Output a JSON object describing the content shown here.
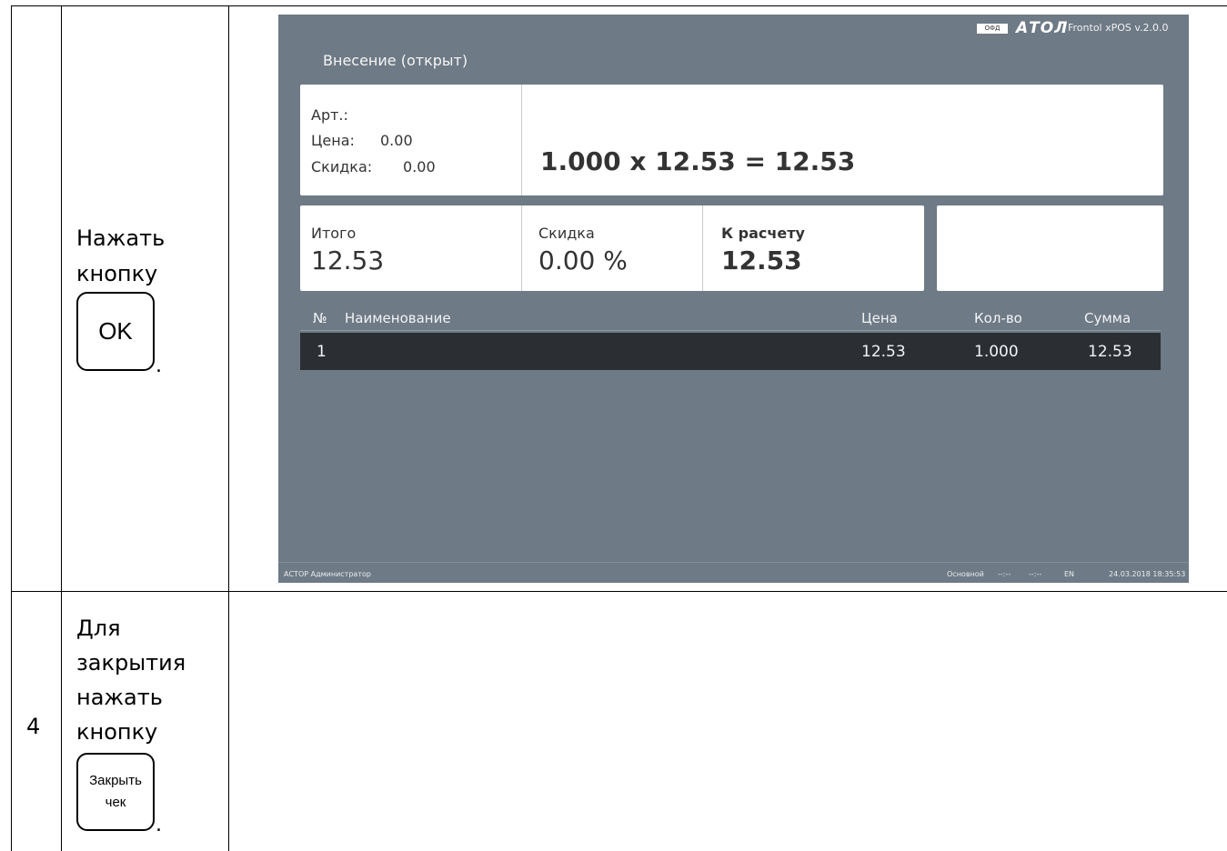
{
  "row3": {
    "instruction_line1": "Нажать",
    "instruction_line2": "кнопку",
    "key_label": "OK",
    "period": "."
  },
  "row4": {
    "number": "4",
    "instruction_lines": [
      "Для",
      "закрытия",
      "нажать",
      "кнопку"
    ],
    "key_line1": "Закрыть",
    "key_line2": "чек",
    "period": "."
  },
  "pos": {
    "ofd_badge": "ОФД",
    "logo": "АТОЛ",
    "version": "Frontol xPOS v.2.0.0",
    "mode_title": "Внесение (открыт)",
    "art_label": "Арт.:",
    "price_label": "Цена:",
    "price_value": "0.00",
    "discount_label": "Скидка:",
    "discount_value": "0.00",
    "formula": "1.000 x 12.53 = 12.53",
    "total_label": "Итого",
    "total_value": "12.53",
    "discount_pct_label": "Скидка",
    "discount_pct_value": "0.00 %",
    "to_pay_label": "К расчету",
    "to_pay_value": "12.53",
    "table": {
      "headers": [
        "№",
        "Наименование",
        "Цена",
        "Кол-во",
        "Сумма"
      ],
      "rows": [
        {
          "num": "1",
          "name": "",
          "price": "12.53",
          "qty": "1.000",
          "sum": "12.53"
        }
      ]
    },
    "footer": {
      "left": "АСТОР Администратор",
      "mode": "Основной",
      "f1": "--:--",
      "f2": "--:--",
      "lang": "EN",
      "datetime": "24.03.2018 18:35:53"
    },
    "colors": {
      "screen_bg": "#6e7a85",
      "selected_row": "#2b2f33"
    }
  }
}
